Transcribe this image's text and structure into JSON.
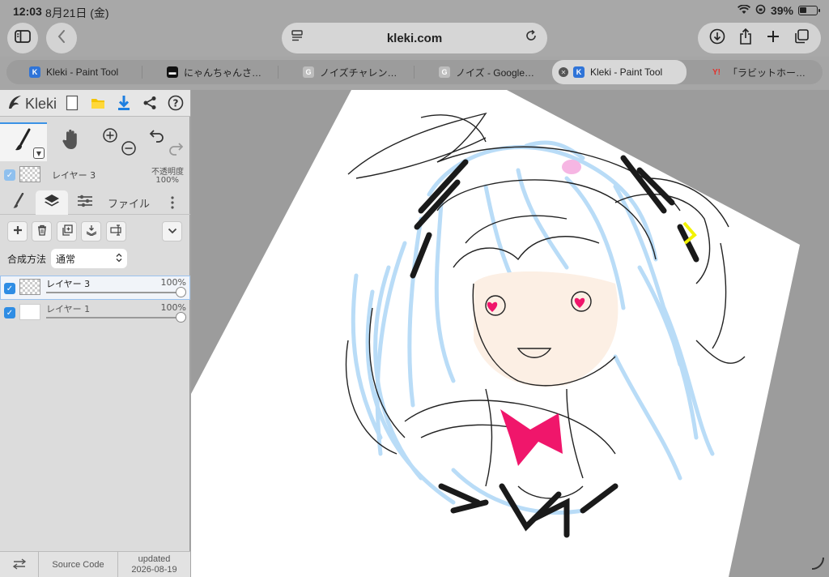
{
  "status": {
    "time": "12:03",
    "date": "8月21日 (金)",
    "battery": "39%"
  },
  "browser": {
    "url": "kleki.com",
    "tabs": [
      {
        "title": "Kleki - Paint Tool",
        "fav_color": "#2f74d8",
        "fav_glyph": "K"
      },
      {
        "title": "にゃんちゃんさ…",
        "fav_color": "#111111",
        "fav_glyph": "▬"
      },
      {
        "title": "ノイズチャレン…",
        "fav_color": "#bdbdbd",
        "fav_glyph": "G"
      },
      {
        "title": "ノイズ - Google…",
        "fav_color": "#bdbdbd",
        "fav_glyph": "G"
      },
      {
        "title": "Kleki - Paint Tool",
        "fav_color": "#2f74d8",
        "fav_glyph": "K",
        "active": true
      },
      {
        "title": "「ラビットホー…",
        "fav_color": "#e2312c",
        "fav_glyph": "Y!"
      }
    ]
  },
  "kleki": {
    "logo": "Kleki",
    "current_layer": {
      "name": "レイヤー 3",
      "opacity_label": "不透明度",
      "opacity": "100%"
    },
    "tabs": {
      "file": "ファイル"
    },
    "blend": {
      "label": "合成方法",
      "value": "通常"
    },
    "layers": [
      {
        "name": "レイヤー 3",
        "opacity": "100%",
        "selected": true
      },
      {
        "name": "レイヤー 1",
        "opacity": "100%",
        "selected": false
      }
    ],
    "footer": {
      "source": "Source Code",
      "updated_label": "updated",
      "updated_date": "2026-08-19"
    }
  },
  "icons": {
    "sidebar": "sidebar-icon",
    "back": "chevron-left-icon",
    "download": "download-icon",
    "share": "share-icon",
    "new_tab": "plus-icon",
    "tabs_overview": "tabs-icon"
  }
}
